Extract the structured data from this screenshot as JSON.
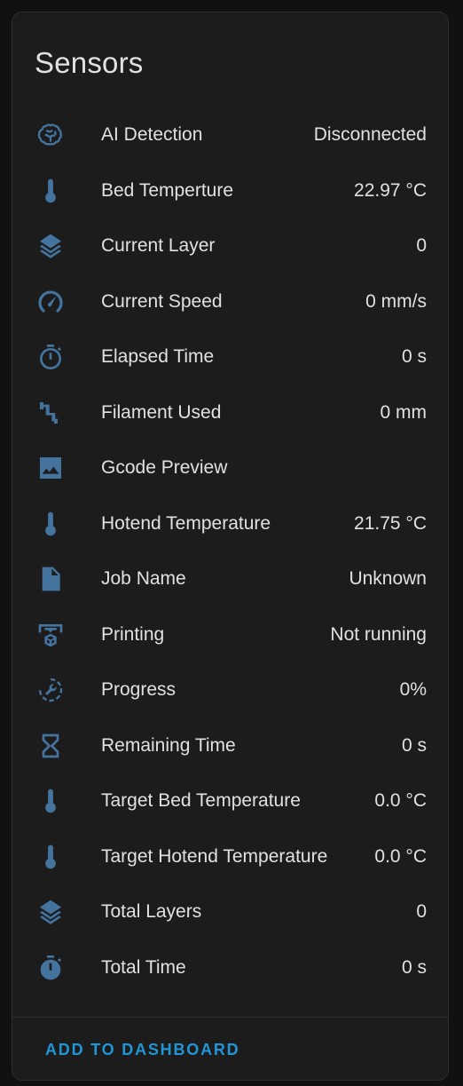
{
  "card": {
    "title": "Sensors",
    "accent_color": "#44739e",
    "action_color": "#2196d6"
  },
  "sensors": [
    {
      "icon": "brain-icon",
      "label": "AI Detection",
      "value": "Disconnected"
    },
    {
      "icon": "thermometer-icon",
      "label": "Bed Temperture",
      "value": "22.97 °C"
    },
    {
      "icon": "layers-icon",
      "label": "Current Layer",
      "value": "0"
    },
    {
      "icon": "speedometer-icon",
      "label": "Current Speed",
      "value": "0 mm/s"
    },
    {
      "icon": "stopwatch-icon",
      "label": "Elapsed Time",
      "value": "0 s"
    },
    {
      "icon": "filament-pipe-icon",
      "label": "Filament Used",
      "value": "0 mm"
    },
    {
      "icon": "image-icon",
      "label": "Gcode Preview",
      "value": ""
    },
    {
      "icon": "thermometer-icon",
      "label": "Hotend Temperature",
      "value": "21.75 °C"
    },
    {
      "icon": "file-document-icon",
      "label": "Job Name",
      "value": "Unknown"
    },
    {
      "icon": "printer-3d-icon",
      "label": "Printing",
      "value": "Not running"
    },
    {
      "icon": "progress-wrench-icon",
      "label": "Progress",
      "value": "0%"
    },
    {
      "icon": "hourglass-icon",
      "label": "Remaining Time",
      "value": "0 s"
    },
    {
      "icon": "thermometer-icon",
      "label": "Target Bed Temperature",
      "value": "0.0 °C"
    },
    {
      "icon": "thermometer-icon",
      "label": "Target Hotend Temperature",
      "value": "0.0 °C"
    },
    {
      "icon": "layers-icon",
      "label": "Total Layers",
      "value": "0"
    },
    {
      "icon": "timer-filled-icon",
      "label": "Total Time",
      "value": "0 s"
    }
  ],
  "footer": {
    "action_label": "ADD TO DASHBOARD"
  }
}
